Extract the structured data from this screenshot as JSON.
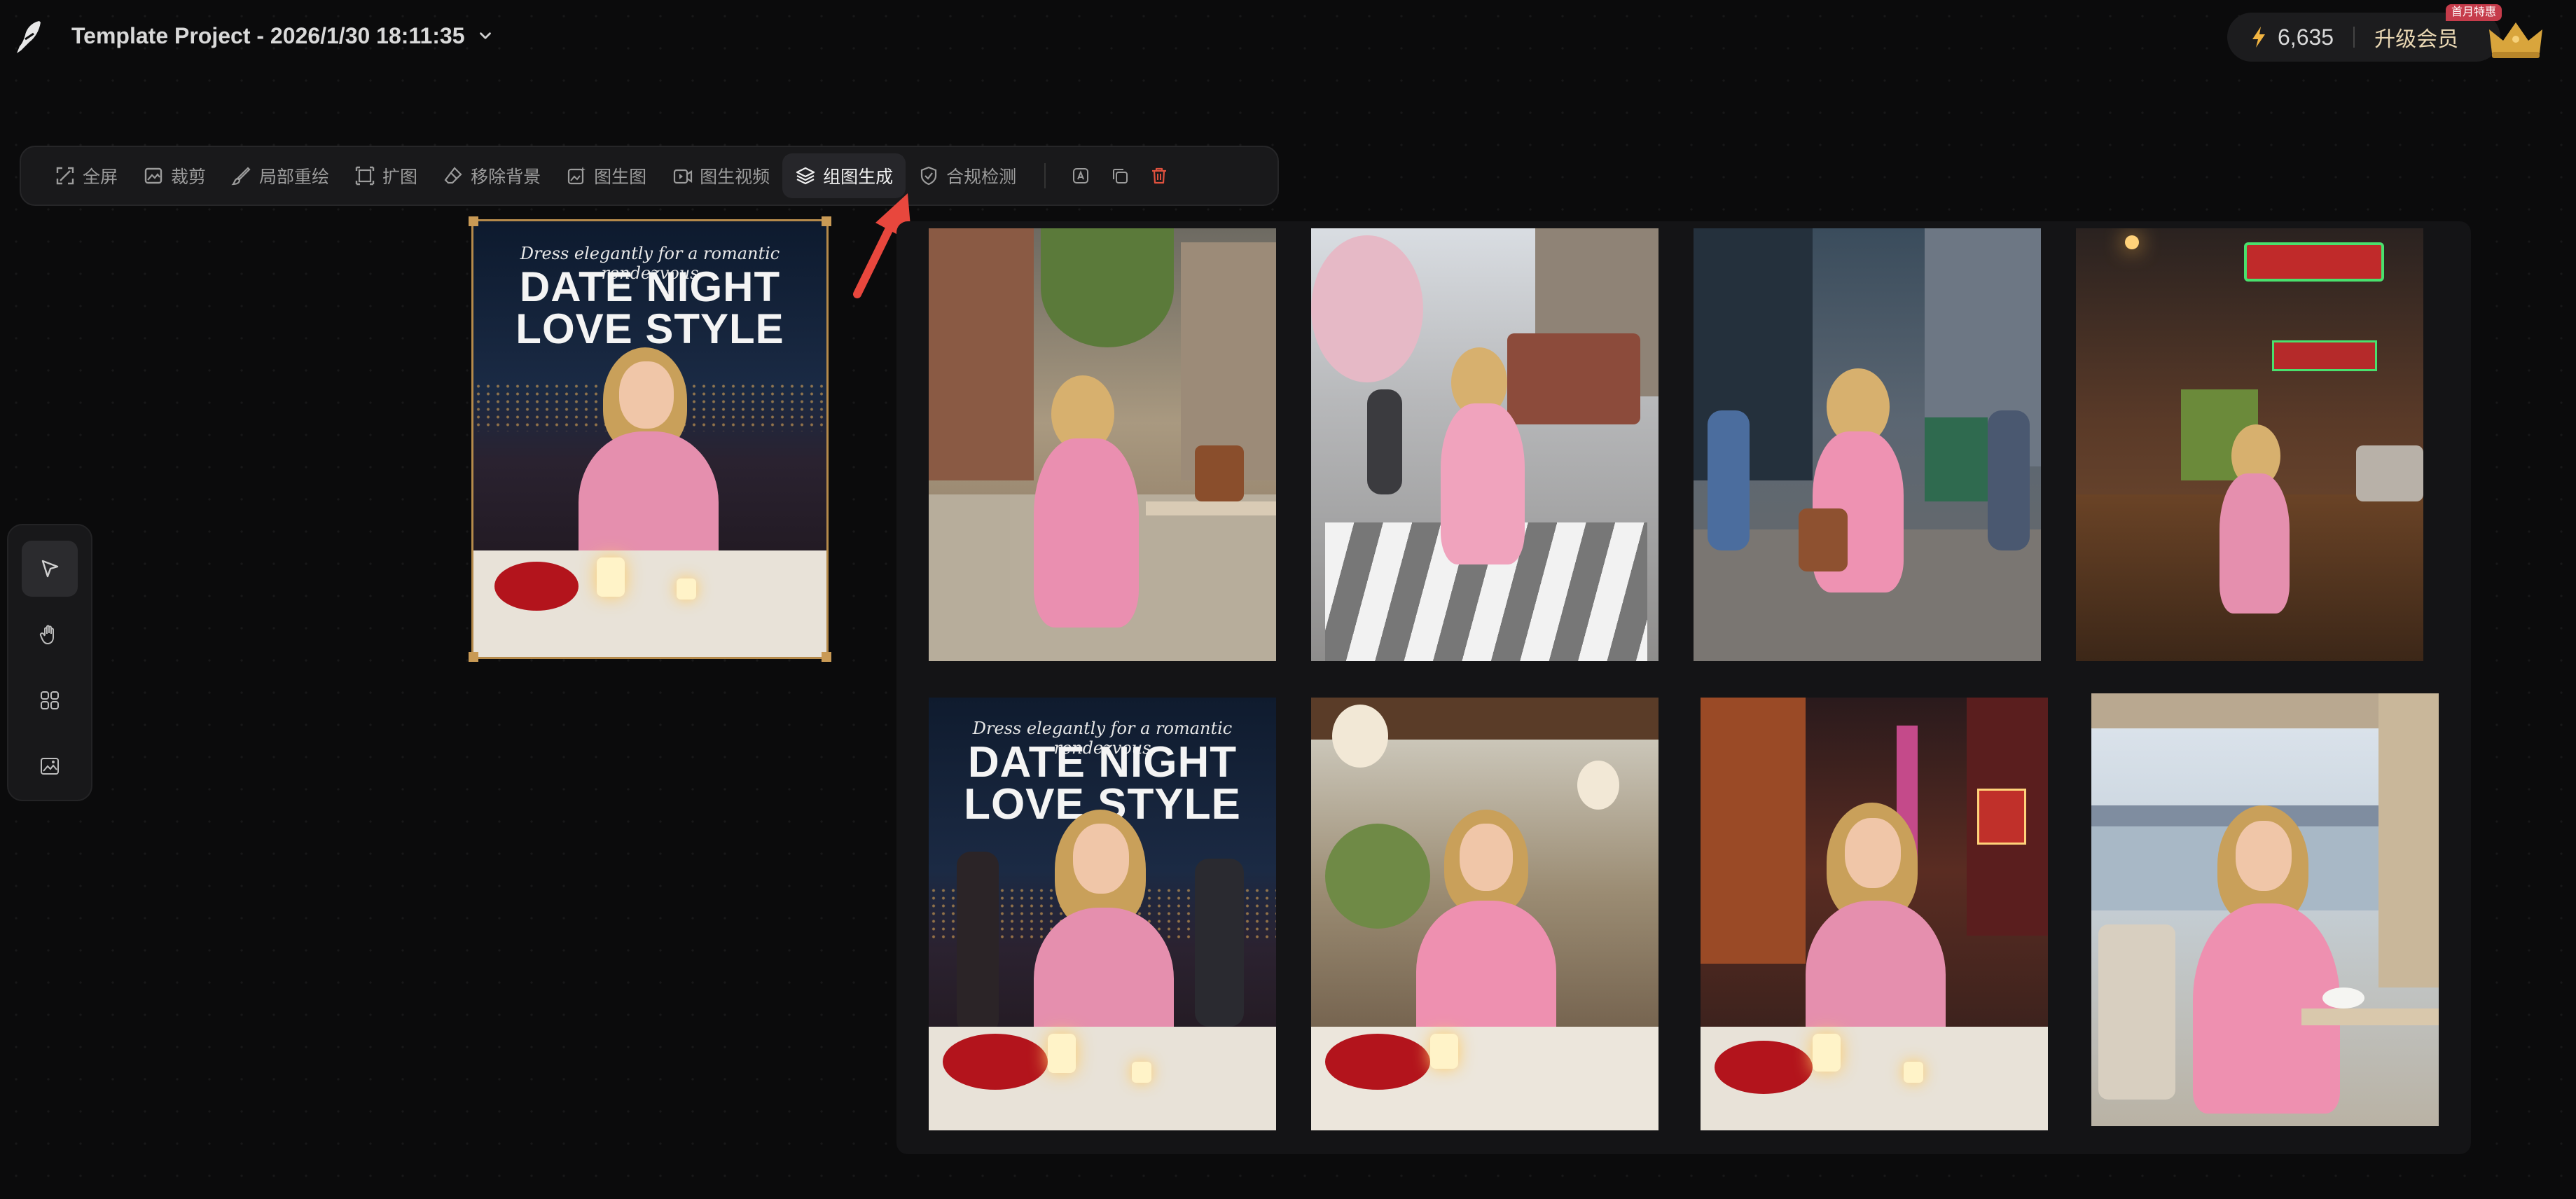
{
  "header": {
    "project_title": "Template Project - 2026/1/30 18:11:35",
    "credits": "6,635",
    "upgrade_label": "升级会员",
    "promo_badge": "首月特惠"
  },
  "toolbar": {
    "items": [
      {
        "label": "全屏",
        "icon": "fullscreen-icon"
      },
      {
        "label": "裁剪",
        "icon": "crop-icon"
      },
      {
        "label": "局部重绘",
        "icon": "brush-icon"
      },
      {
        "label": "扩图",
        "icon": "expand-icon"
      },
      {
        "label": "移除背景",
        "icon": "eraser-icon"
      },
      {
        "label": "图生图",
        "icon": "image-to-image-icon"
      },
      {
        "label": "图生视频",
        "icon": "image-to-video-icon"
      },
      {
        "label": "组图生成",
        "icon": "layers-icon",
        "active": true
      },
      {
        "label": "合规检测",
        "icon": "shield-icon"
      }
    ],
    "icon_buttons": [
      "text-icon",
      "duplicate-icon",
      "trash-icon"
    ]
  },
  "side_tools": [
    "select-arrow-icon",
    "hand-icon",
    "apps-grid-icon",
    "image-icon"
  ],
  "poster": {
    "subtitle": "Dress elegantly for a romantic rendezvous",
    "title_line1": "DATE NIGHT",
    "title_line2": "LOVE STYLE"
  },
  "colors": {
    "accent_arrow": "#e8473d",
    "selection_border": "#b58a4b",
    "delete_icon": "#e0513e"
  }
}
